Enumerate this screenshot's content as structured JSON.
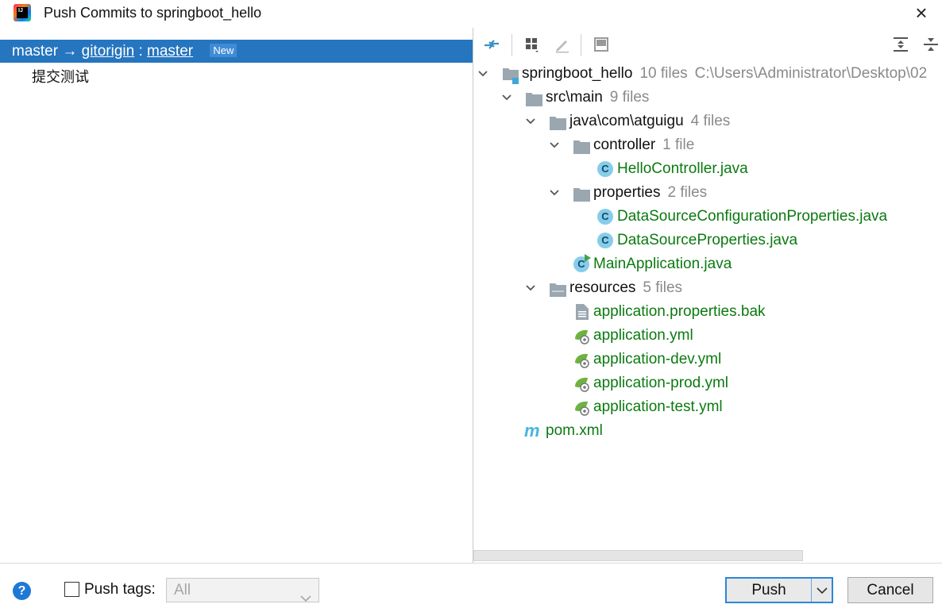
{
  "window": {
    "title": "Push Commits to springboot_hello",
    "app_icon_text": "IJ"
  },
  "left": {
    "branch": {
      "local": "master",
      "arrow": "→",
      "remote": "gitorigin",
      "sep": ":",
      "remote_branch": "master",
      "badge": "New"
    },
    "commits": [
      {
        "message": "提交测试"
      }
    ]
  },
  "toolbar": {
    "icons": [
      "compare-icon",
      "group-icon",
      "edit-icon",
      "preview-icon",
      "expand-all-icon",
      "collapse-all-icon"
    ]
  },
  "tree": {
    "root": {
      "name": "springboot_hello",
      "count": "10 files",
      "path": "C:\\Users\\Administrator\\Desktop\\02"
    },
    "src_main": {
      "name": "src\\main",
      "count": "9 files"
    },
    "java_pkg": {
      "name": "java\\com\\atguigu",
      "count": "4 files"
    },
    "controller": {
      "name": "controller",
      "count": "1 file"
    },
    "hello_controller": {
      "name": "HelloController.java"
    },
    "properties": {
      "name": "properties",
      "count": "2 files"
    },
    "ds_config_props": {
      "name": "DataSourceConfigurationProperties.java"
    },
    "ds_props": {
      "name": "DataSourceProperties.java"
    },
    "main_app": {
      "name": "MainApplication.java"
    },
    "resources": {
      "name": "resources",
      "count": "5 files"
    },
    "app_props_bak": {
      "name": "application.properties.bak"
    },
    "app_yml": {
      "name": "application.yml"
    },
    "app_dev_yml": {
      "name": "application-dev.yml"
    },
    "app_prod_yml": {
      "name": "application-prod.yml"
    },
    "app_test_yml": {
      "name": "application-test.yml"
    },
    "pom": {
      "name": "pom.xml"
    }
  },
  "footer": {
    "help": "?",
    "push_tags_label": "Push tags:",
    "push_tags_checked": false,
    "tags_select_value": "All",
    "push_label": "Push",
    "cancel_label": "Cancel"
  },
  "colors": {
    "selection": "#2675bf",
    "modified_file": "#0b7a10",
    "count_gray": "#8a8a8a",
    "primary_border": "#2d86d8"
  }
}
